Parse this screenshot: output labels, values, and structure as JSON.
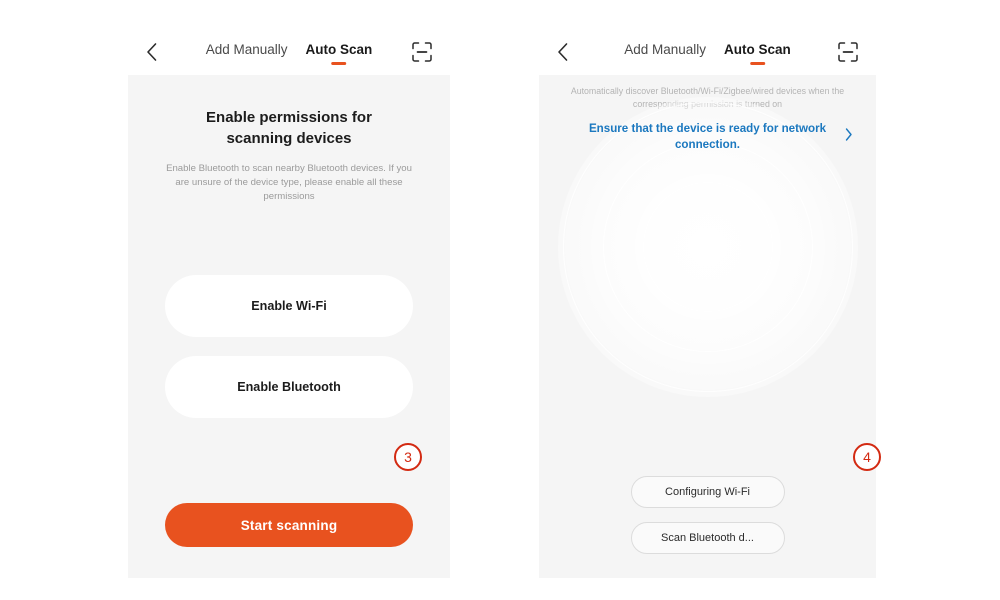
{
  "theme": {
    "accent": "#e8521f",
    "badge_red": "#d32a12",
    "link_blue": "#1b78bf",
    "screen_bg": "#f5f5f5"
  },
  "panels": {
    "left": {
      "header": {
        "back_icon": "chevron-left-icon",
        "tabs": [
          {
            "label": "Add Manually",
            "active": false
          },
          {
            "label": "Auto Scan",
            "active": true
          }
        ],
        "scan_icon": "scan-frame-icon"
      },
      "title": "Enable permissions for scanning devices",
      "description": "Enable Bluetooth to scan nearby Bluetooth devices. If you are unsure of the device type, please enable all these permissions",
      "buttons": [
        {
          "label": "Enable Wi-Fi"
        },
        {
          "label": "Enable Bluetooth"
        }
      ],
      "cta": {
        "label": "Start scanning"
      },
      "step_badge": "3"
    },
    "right": {
      "header": {
        "back_icon": "chevron-left-icon",
        "tabs": [
          {
            "label": "Add Manually",
            "active": false
          },
          {
            "label": "Auto Scan",
            "active": true
          }
        ],
        "scan_icon": "scan-frame-icon"
      },
      "description": "Automatically discover Bluetooth/Wi-Fi/Zigbee/wired devices when the corresponding permission is turned on",
      "link": {
        "label": "Ensure that the device is ready for network connection.",
        "chevron": "›"
      },
      "chips": [
        {
          "label": "Configuring Wi-Fi"
        },
        {
          "label": "Scan Bluetooth d..."
        }
      ],
      "step_badge": "4"
    }
  }
}
